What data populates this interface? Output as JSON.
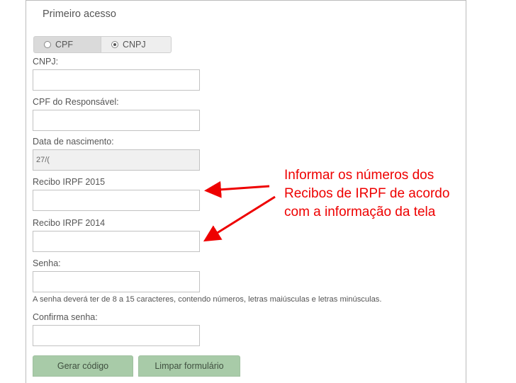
{
  "form": {
    "title": "Primeiro acesso",
    "tabs": [
      {
        "label": "CPF",
        "selected": false
      },
      {
        "label": "CNPJ",
        "selected": true
      }
    ],
    "fields": {
      "cnpj": {
        "label": "CNPJ:",
        "value": ""
      },
      "cpf_responsavel": {
        "label": "CPF do Responsável:",
        "value": ""
      },
      "data_nascimento": {
        "label": "Data de nascimento:",
        "value": "27/("
      },
      "recibo_2015": {
        "label": "Recibo IRPF 2015",
        "value": ""
      },
      "recibo_2014": {
        "label": "Recibo IRPF 2014",
        "value": ""
      },
      "senha": {
        "label": "Senha:",
        "value": ""
      },
      "confirma_senha": {
        "label": "Confirma senha:",
        "value": ""
      }
    },
    "password_hint": "A senha deverá ter de 8 a 15 caracteres, contendo números, letras maiúsculas e letras minúsculas.",
    "buttons": {
      "gerar_codigo": "Gerar código",
      "limpar_formulario": "Limpar formulário"
    }
  },
  "annotation": {
    "lines": [
      "Informar os números dos",
      "Recibos de IRPF de acordo",
      "com a informação da tela"
    ],
    "color": "#ee0000"
  }
}
